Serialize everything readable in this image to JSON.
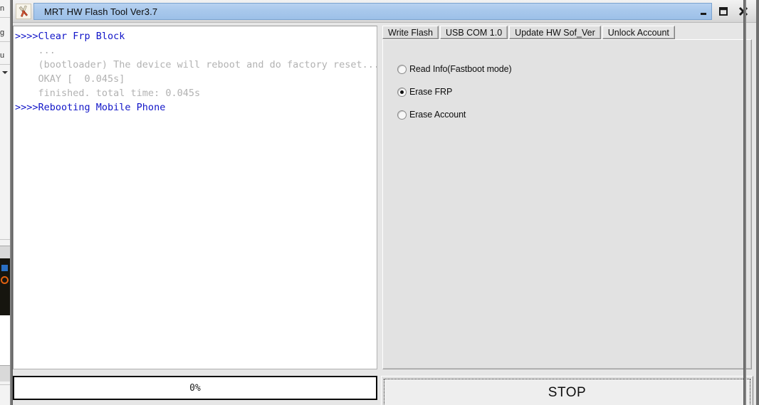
{
  "window": {
    "title": "MRT HW Flash Tool Ver3.7",
    "icon": "tools-hammer-icon",
    "controls": {
      "minimize": "minimize-icon",
      "maximize": "maximize-icon",
      "close": "close-icon"
    },
    "titlebar_color": "#a8c8ec"
  },
  "console": {
    "lines": [
      {
        "text": ">>>>Clear Frp Block",
        "style": "blue"
      },
      {
        "text": "    ...",
        "style": "gray"
      },
      {
        "text": "    (bootloader) The device will reboot and do factory reset...",
        "style": "gray"
      },
      {
        "text": "    OKAY [  0.045s]",
        "style": "gray"
      },
      {
        "text": "    finished. total time: 0.045s",
        "style": "gray"
      },
      {
        "text": ">>>>Rebooting Mobile Phone",
        "style": "blue"
      }
    ]
  },
  "progress": {
    "label": "0%",
    "value": 0
  },
  "tabs": [
    {
      "label": "Write Flash",
      "active": false
    },
    {
      "label": "USB COM 1.0",
      "active": false
    },
    {
      "label": "Update HW Sof_Ver",
      "active": false
    },
    {
      "label": "Unlock Account",
      "active": true
    }
  ],
  "options": {
    "items": [
      {
        "label": "Read Info(Fastboot mode)",
        "checked": false
      },
      {
        "label": "Erase FRP",
        "checked": true
      },
      {
        "label": "Erase Account",
        "checked": false
      }
    ]
  },
  "actions": {
    "stop_label": "STOP"
  },
  "background": {
    "fragments": [
      "n",
      "g",
      "u"
    ]
  }
}
